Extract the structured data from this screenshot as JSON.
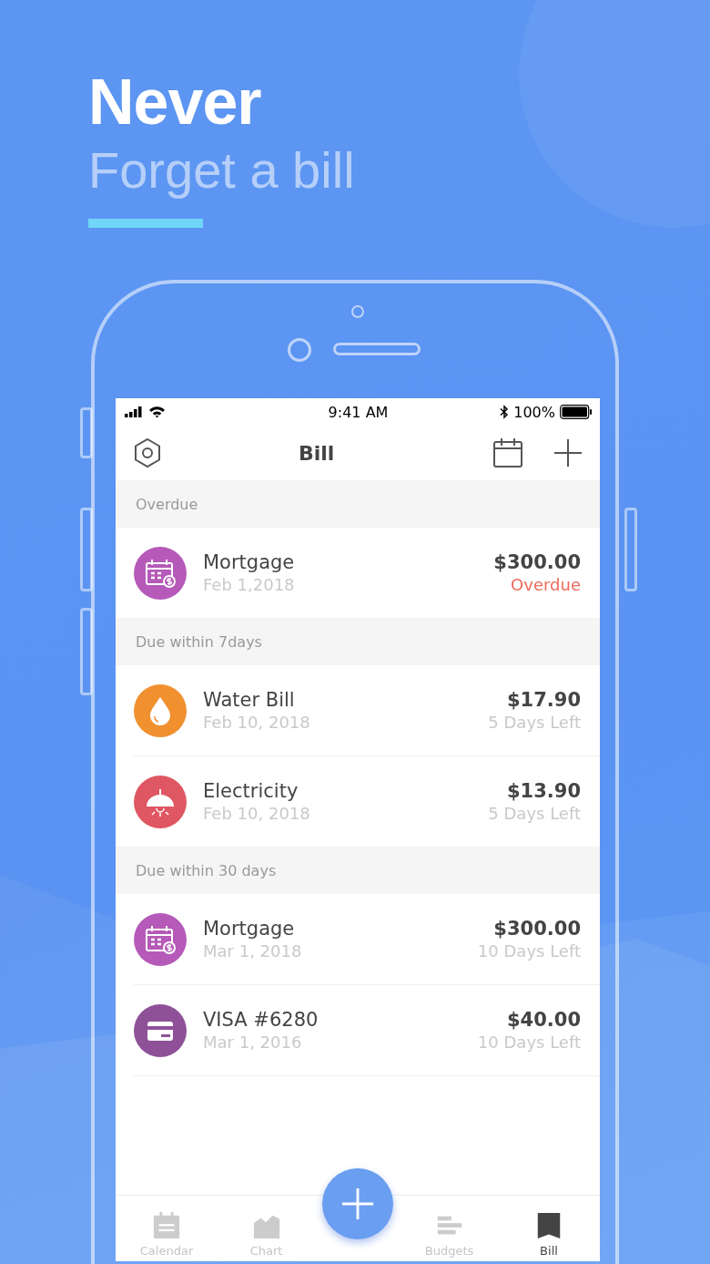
{
  "headline": {
    "title": "Never",
    "subtitle": "Forget a bill"
  },
  "status_bar": {
    "time": "9:41 AM",
    "battery": "100%"
  },
  "nav": {
    "title": "Bill"
  },
  "sections": [
    {
      "title": "Overdue",
      "bills": [
        {
          "name": "Mortgage",
          "date": "Feb 1,2018",
          "amount": "$300.00",
          "status": "Overdue",
          "overdue": true,
          "kind": "mortgage",
          "color": "#b55ab8"
        }
      ]
    },
    {
      "title": "Due within 7days",
      "bills": [
        {
          "name": "Water Bill",
          "date": "Feb 10, 2018",
          "amount": "$17.90",
          "status": "5 Days Left",
          "overdue": false,
          "kind": "water",
          "color": "#f0902e"
        },
        {
          "name": "Electricity",
          "date": "Feb 10, 2018",
          "amount": "$13.90",
          "status": "5 Days Left",
          "overdue": false,
          "kind": "electricity",
          "color": "#df5762"
        }
      ]
    },
    {
      "title": "Due within 30 days",
      "bills": [
        {
          "name": "Mortgage",
          "date": "Mar 1, 2018",
          "amount": "$300.00",
          "status": "10 Days Left",
          "overdue": false,
          "kind": "mortgage",
          "color": "#b55ab8"
        },
        {
          "name": "VISA #6280",
          "date": "Mar 1, 2016",
          "amount": "$40.00",
          "status": "10 Days Left",
          "overdue": false,
          "kind": "card",
          "color": "#8e5198"
        }
      ]
    }
  ],
  "tabs": [
    {
      "kind": "calendar",
      "label": "Calendar",
      "selected": false
    },
    {
      "kind": "chart",
      "label": "Chart",
      "selected": false
    },
    {
      "kind": "add"
    },
    {
      "kind": "budgets",
      "label": "Budgets",
      "selected": false
    },
    {
      "kind": "bill",
      "label": "Bill",
      "selected": true
    }
  ]
}
